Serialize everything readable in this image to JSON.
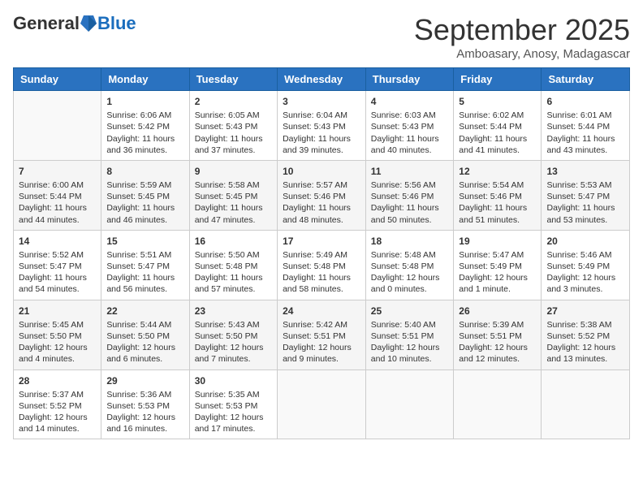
{
  "header": {
    "logo": {
      "general": "General",
      "blue": "Blue"
    },
    "title": "September 2025",
    "subtitle": "Amboasary, Anosy, Madagascar"
  },
  "days": [
    "Sunday",
    "Monday",
    "Tuesday",
    "Wednesday",
    "Thursday",
    "Friday",
    "Saturday"
  ],
  "weeks": [
    [
      {
        "day": "",
        "sunrise": "",
        "sunset": "",
        "daylight": ""
      },
      {
        "day": "1",
        "sunrise": "Sunrise: 6:06 AM",
        "sunset": "Sunset: 5:42 PM",
        "daylight": "Daylight: 11 hours and 36 minutes."
      },
      {
        "day": "2",
        "sunrise": "Sunrise: 6:05 AM",
        "sunset": "Sunset: 5:43 PM",
        "daylight": "Daylight: 11 hours and 37 minutes."
      },
      {
        "day": "3",
        "sunrise": "Sunrise: 6:04 AM",
        "sunset": "Sunset: 5:43 PM",
        "daylight": "Daylight: 11 hours and 39 minutes."
      },
      {
        "day": "4",
        "sunrise": "Sunrise: 6:03 AM",
        "sunset": "Sunset: 5:43 PM",
        "daylight": "Daylight: 11 hours and 40 minutes."
      },
      {
        "day": "5",
        "sunrise": "Sunrise: 6:02 AM",
        "sunset": "Sunset: 5:44 PM",
        "daylight": "Daylight: 11 hours and 41 minutes."
      },
      {
        "day": "6",
        "sunrise": "Sunrise: 6:01 AM",
        "sunset": "Sunset: 5:44 PM",
        "daylight": "Daylight: 11 hours and 43 minutes."
      }
    ],
    [
      {
        "day": "7",
        "sunrise": "Sunrise: 6:00 AM",
        "sunset": "Sunset: 5:44 PM",
        "daylight": "Daylight: 11 hours and 44 minutes."
      },
      {
        "day": "8",
        "sunrise": "Sunrise: 5:59 AM",
        "sunset": "Sunset: 5:45 PM",
        "daylight": "Daylight: 11 hours and 46 minutes."
      },
      {
        "day": "9",
        "sunrise": "Sunrise: 5:58 AM",
        "sunset": "Sunset: 5:45 PM",
        "daylight": "Daylight: 11 hours and 47 minutes."
      },
      {
        "day": "10",
        "sunrise": "Sunrise: 5:57 AM",
        "sunset": "Sunset: 5:46 PM",
        "daylight": "Daylight: 11 hours and 48 minutes."
      },
      {
        "day": "11",
        "sunrise": "Sunrise: 5:56 AM",
        "sunset": "Sunset: 5:46 PM",
        "daylight": "Daylight: 11 hours and 50 minutes."
      },
      {
        "day": "12",
        "sunrise": "Sunrise: 5:54 AM",
        "sunset": "Sunset: 5:46 PM",
        "daylight": "Daylight: 11 hours and 51 minutes."
      },
      {
        "day": "13",
        "sunrise": "Sunrise: 5:53 AM",
        "sunset": "Sunset: 5:47 PM",
        "daylight": "Daylight: 11 hours and 53 minutes."
      }
    ],
    [
      {
        "day": "14",
        "sunrise": "Sunrise: 5:52 AM",
        "sunset": "Sunset: 5:47 PM",
        "daylight": "Daylight: 11 hours and 54 minutes."
      },
      {
        "day": "15",
        "sunrise": "Sunrise: 5:51 AM",
        "sunset": "Sunset: 5:47 PM",
        "daylight": "Daylight: 11 hours and 56 minutes."
      },
      {
        "day": "16",
        "sunrise": "Sunrise: 5:50 AM",
        "sunset": "Sunset: 5:48 PM",
        "daylight": "Daylight: 11 hours and 57 minutes."
      },
      {
        "day": "17",
        "sunrise": "Sunrise: 5:49 AM",
        "sunset": "Sunset: 5:48 PM",
        "daylight": "Daylight: 11 hours and 58 minutes."
      },
      {
        "day": "18",
        "sunrise": "Sunrise: 5:48 AM",
        "sunset": "Sunset: 5:48 PM",
        "daylight": "Daylight: 12 hours and 0 minutes."
      },
      {
        "day": "19",
        "sunrise": "Sunrise: 5:47 AM",
        "sunset": "Sunset: 5:49 PM",
        "daylight": "Daylight: 12 hours and 1 minute."
      },
      {
        "day": "20",
        "sunrise": "Sunrise: 5:46 AM",
        "sunset": "Sunset: 5:49 PM",
        "daylight": "Daylight: 12 hours and 3 minutes."
      }
    ],
    [
      {
        "day": "21",
        "sunrise": "Sunrise: 5:45 AM",
        "sunset": "Sunset: 5:50 PM",
        "daylight": "Daylight: 12 hours and 4 minutes."
      },
      {
        "day": "22",
        "sunrise": "Sunrise: 5:44 AM",
        "sunset": "Sunset: 5:50 PM",
        "daylight": "Daylight: 12 hours and 6 minutes."
      },
      {
        "day": "23",
        "sunrise": "Sunrise: 5:43 AM",
        "sunset": "Sunset: 5:50 PM",
        "daylight": "Daylight: 12 hours and 7 minutes."
      },
      {
        "day": "24",
        "sunrise": "Sunrise: 5:42 AM",
        "sunset": "Sunset: 5:51 PM",
        "daylight": "Daylight: 12 hours and 9 minutes."
      },
      {
        "day": "25",
        "sunrise": "Sunrise: 5:40 AM",
        "sunset": "Sunset: 5:51 PM",
        "daylight": "Daylight: 12 hours and 10 minutes."
      },
      {
        "day": "26",
        "sunrise": "Sunrise: 5:39 AM",
        "sunset": "Sunset: 5:51 PM",
        "daylight": "Daylight: 12 hours and 12 minutes."
      },
      {
        "day": "27",
        "sunrise": "Sunrise: 5:38 AM",
        "sunset": "Sunset: 5:52 PM",
        "daylight": "Daylight: 12 hours and 13 minutes."
      }
    ],
    [
      {
        "day": "28",
        "sunrise": "Sunrise: 5:37 AM",
        "sunset": "Sunset: 5:52 PM",
        "daylight": "Daylight: 12 hours and 14 minutes."
      },
      {
        "day": "29",
        "sunrise": "Sunrise: 5:36 AM",
        "sunset": "Sunset: 5:53 PM",
        "daylight": "Daylight: 12 hours and 16 minutes."
      },
      {
        "day": "30",
        "sunrise": "Sunrise: 5:35 AM",
        "sunset": "Sunset: 5:53 PM",
        "daylight": "Daylight: 12 hours and 17 minutes."
      },
      {
        "day": "",
        "sunrise": "",
        "sunset": "",
        "daylight": ""
      },
      {
        "day": "",
        "sunrise": "",
        "sunset": "",
        "daylight": ""
      },
      {
        "day": "",
        "sunrise": "",
        "sunset": "",
        "daylight": ""
      },
      {
        "day": "",
        "sunrise": "",
        "sunset": "",
        "daylight": ""
      }
    ]
  ]
}
